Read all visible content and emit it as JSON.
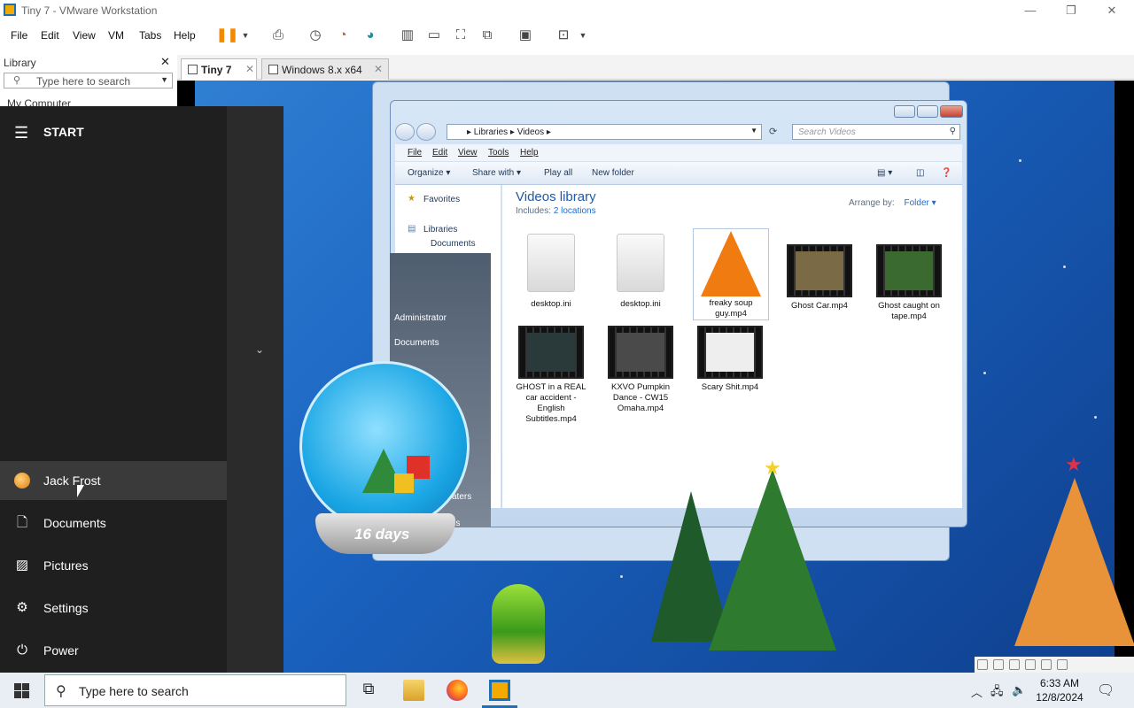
{
  "window": {
    "title": "Tiny 7 - VMware Workstation",
    "minimize": "—",
    "restore": "❐",
    "close": "✕"
  },
  "menu": [
    "File",
    "Edit",
    "View",
    "VM",
    "Tabs",
    "Help"
  ],
  "library": {
    "label": "Library",
    "close": "✕",
    "search_placeholder": "Type here to search",
    "first_item": "My Computer"
  },
  "tabs": [
    {
      "label": "Tiny 7",
      "close": "✕"
    },
    {
      "label": "Windows 8.x x64",
      "close": "✕"
    }
  ],
  "explorer": {
    "path": "▸ Libraries ▸ Videos ▸",
    "search_placeholder": "Search Videos",
    "menu": [
      "File",
      "Edit",
      "View",
      "Tools",
      "Help"
    ],
    "commands": [
      "Organize ▾",
      "Share with ▾",
      "Play all",
      "New folder"
    ],
    "nav": [
      "Favorites",
      "Libraries",
      "Documents"
    ],
    "library_title": "Videos library",
    "includes_label": "Includes:",
    "includes_link": "2 locations",
    "arrange_label": "Arrange by:",
    "arrange_value": "Folder ▾",
    "files": [
      {
        "name": "desktop.ini",
        "kind": "ini"
      },
      {
        "name": "desktop.ini",
        "kind": "ini"
      },
      {
        "name": "freaky soup guy.mp4",
        "kind": "vlc"
      },
      {
        "name": "Ghost Car.mp4",
        "kind": "video"
      },
      {
        "name": "Ghost caught on tape.mp4",
        "kind": "video"
      },
      {
        "name": "GHOST in a REAL car accident - English Subtitles.mp4",
        "kind": "video"
      },
      {
        "name": "KXVO Pumpkin Dance - CW15 Omaha.mp4",
        "kind": "video"
      },
      {
        "name": "Scary Shit.mp4",
        "kind": "video"
      }
    ]
  },
  "guest_startpanel": [
    "Administrator",
    "Documents"
  ],
  "guest_startpanel_partial": [
    "aters",
    "ms"
  ],
  "countdown": "16 days",
  "start_menu": {
    "title": "START",
    "user": "Jack Frost",
    "items": [
      "Documents",
      "Pictures",
      "Settings",
      "Power"
    ]
  },
  "taskbar": {
    "search_placeholder": "Type here to search",
    "time": "6:33 AM",
    "date": "12/8/2024"
  }
}
